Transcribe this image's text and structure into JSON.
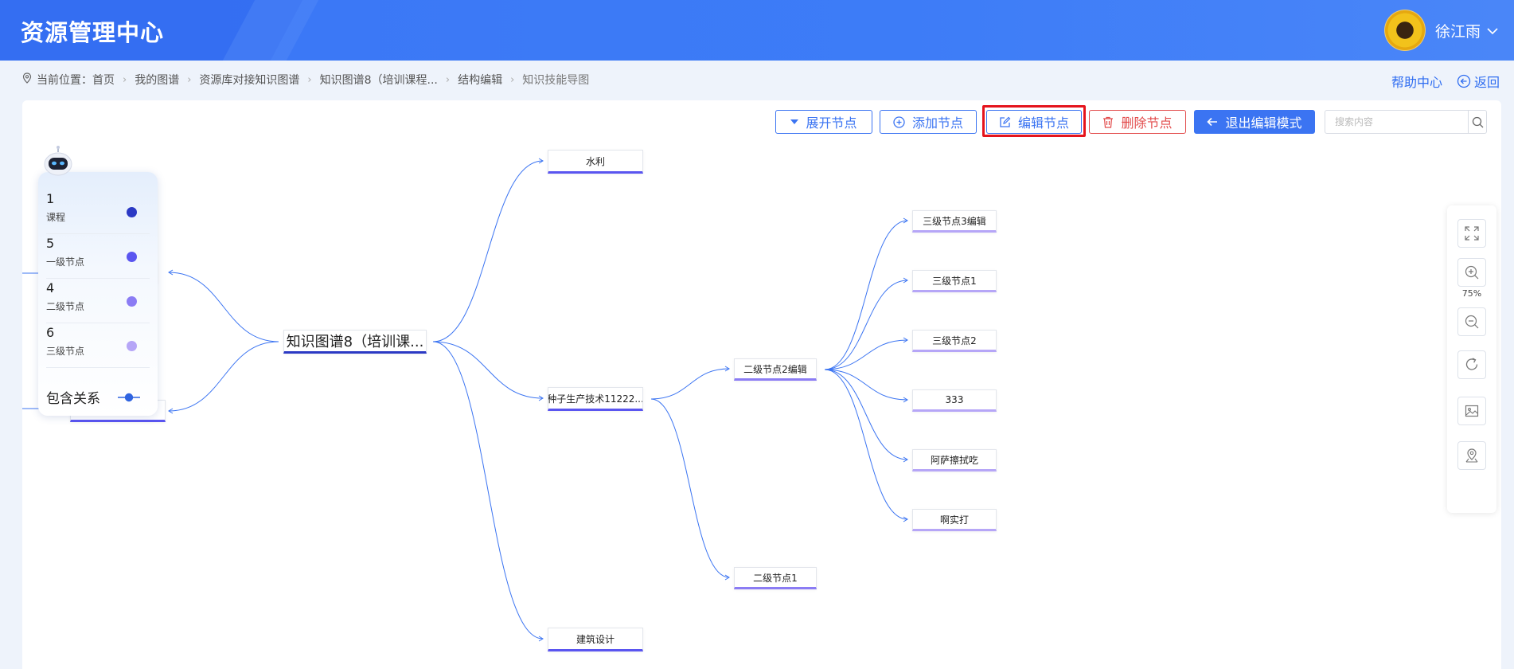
{
  "header": {
    "title": "资源管理中心",
    "user_name": "徐江雨"
  },
  "breadcrumb": {
    "prefix": "当前位置：",
    "items": [
      "首页",
      "我的图谱",
      "资源库对接知识图谱",
      "知识图谱8（培训课程...",
      "结构编辑",
      "知识技能导图"
    ]
  },
  "top_links": {
    "help": "帮助中心",
    "back": "返回"
  },
  "toolbar": {
    "expand": "展开节点",
    "add": "添加节点",
    "edit": "编辑节点",
    "delete": "删除节点",
    "exit": "退出编辑模式",
    "search_placeholder": "搜索内容"
  },
  "map": {
    "root": "知识图谱8（培训课...",
    "level1": [
      "水利",
      "种子生产技术11222...",
      "建筑设计"
    ],
    "level2": [
      "二级节点2编辑",
      "二级节点1"
    ],
    "level3": [
      "三级节点3编辑",
      "三级节点1",
      "三级节点2",
      "333",
      "阿萨擦拭吃",
      "啊实打"
    ]
  },
  "legend": {
    "items": [
      {
        "count": "1",
        "label": "课程",
        "color": "#2b39c4"
      },
      {
        "count": "5",
        "label": "一级节点",
        "color": "#5a55f0"
      },
      {
        "count": "4",
        "label": "二级节点",
        "color": "#8b7cf4"
      },
      {
        "count": "6",
        "label": "三级节点",
        "color": "#b6a6f7"
      }
    ],
    "relation": "包含关系",
    "relation_color": "#2f64e0"
  },
  "zoom": {
    "level": "75%"
  },
  "colors": {
    "accent": "#3b74f2",
    "danger": "#e24b4b",
    "highlight": "#e5141c",
    "edge": "#3b74f2"
  }
}
